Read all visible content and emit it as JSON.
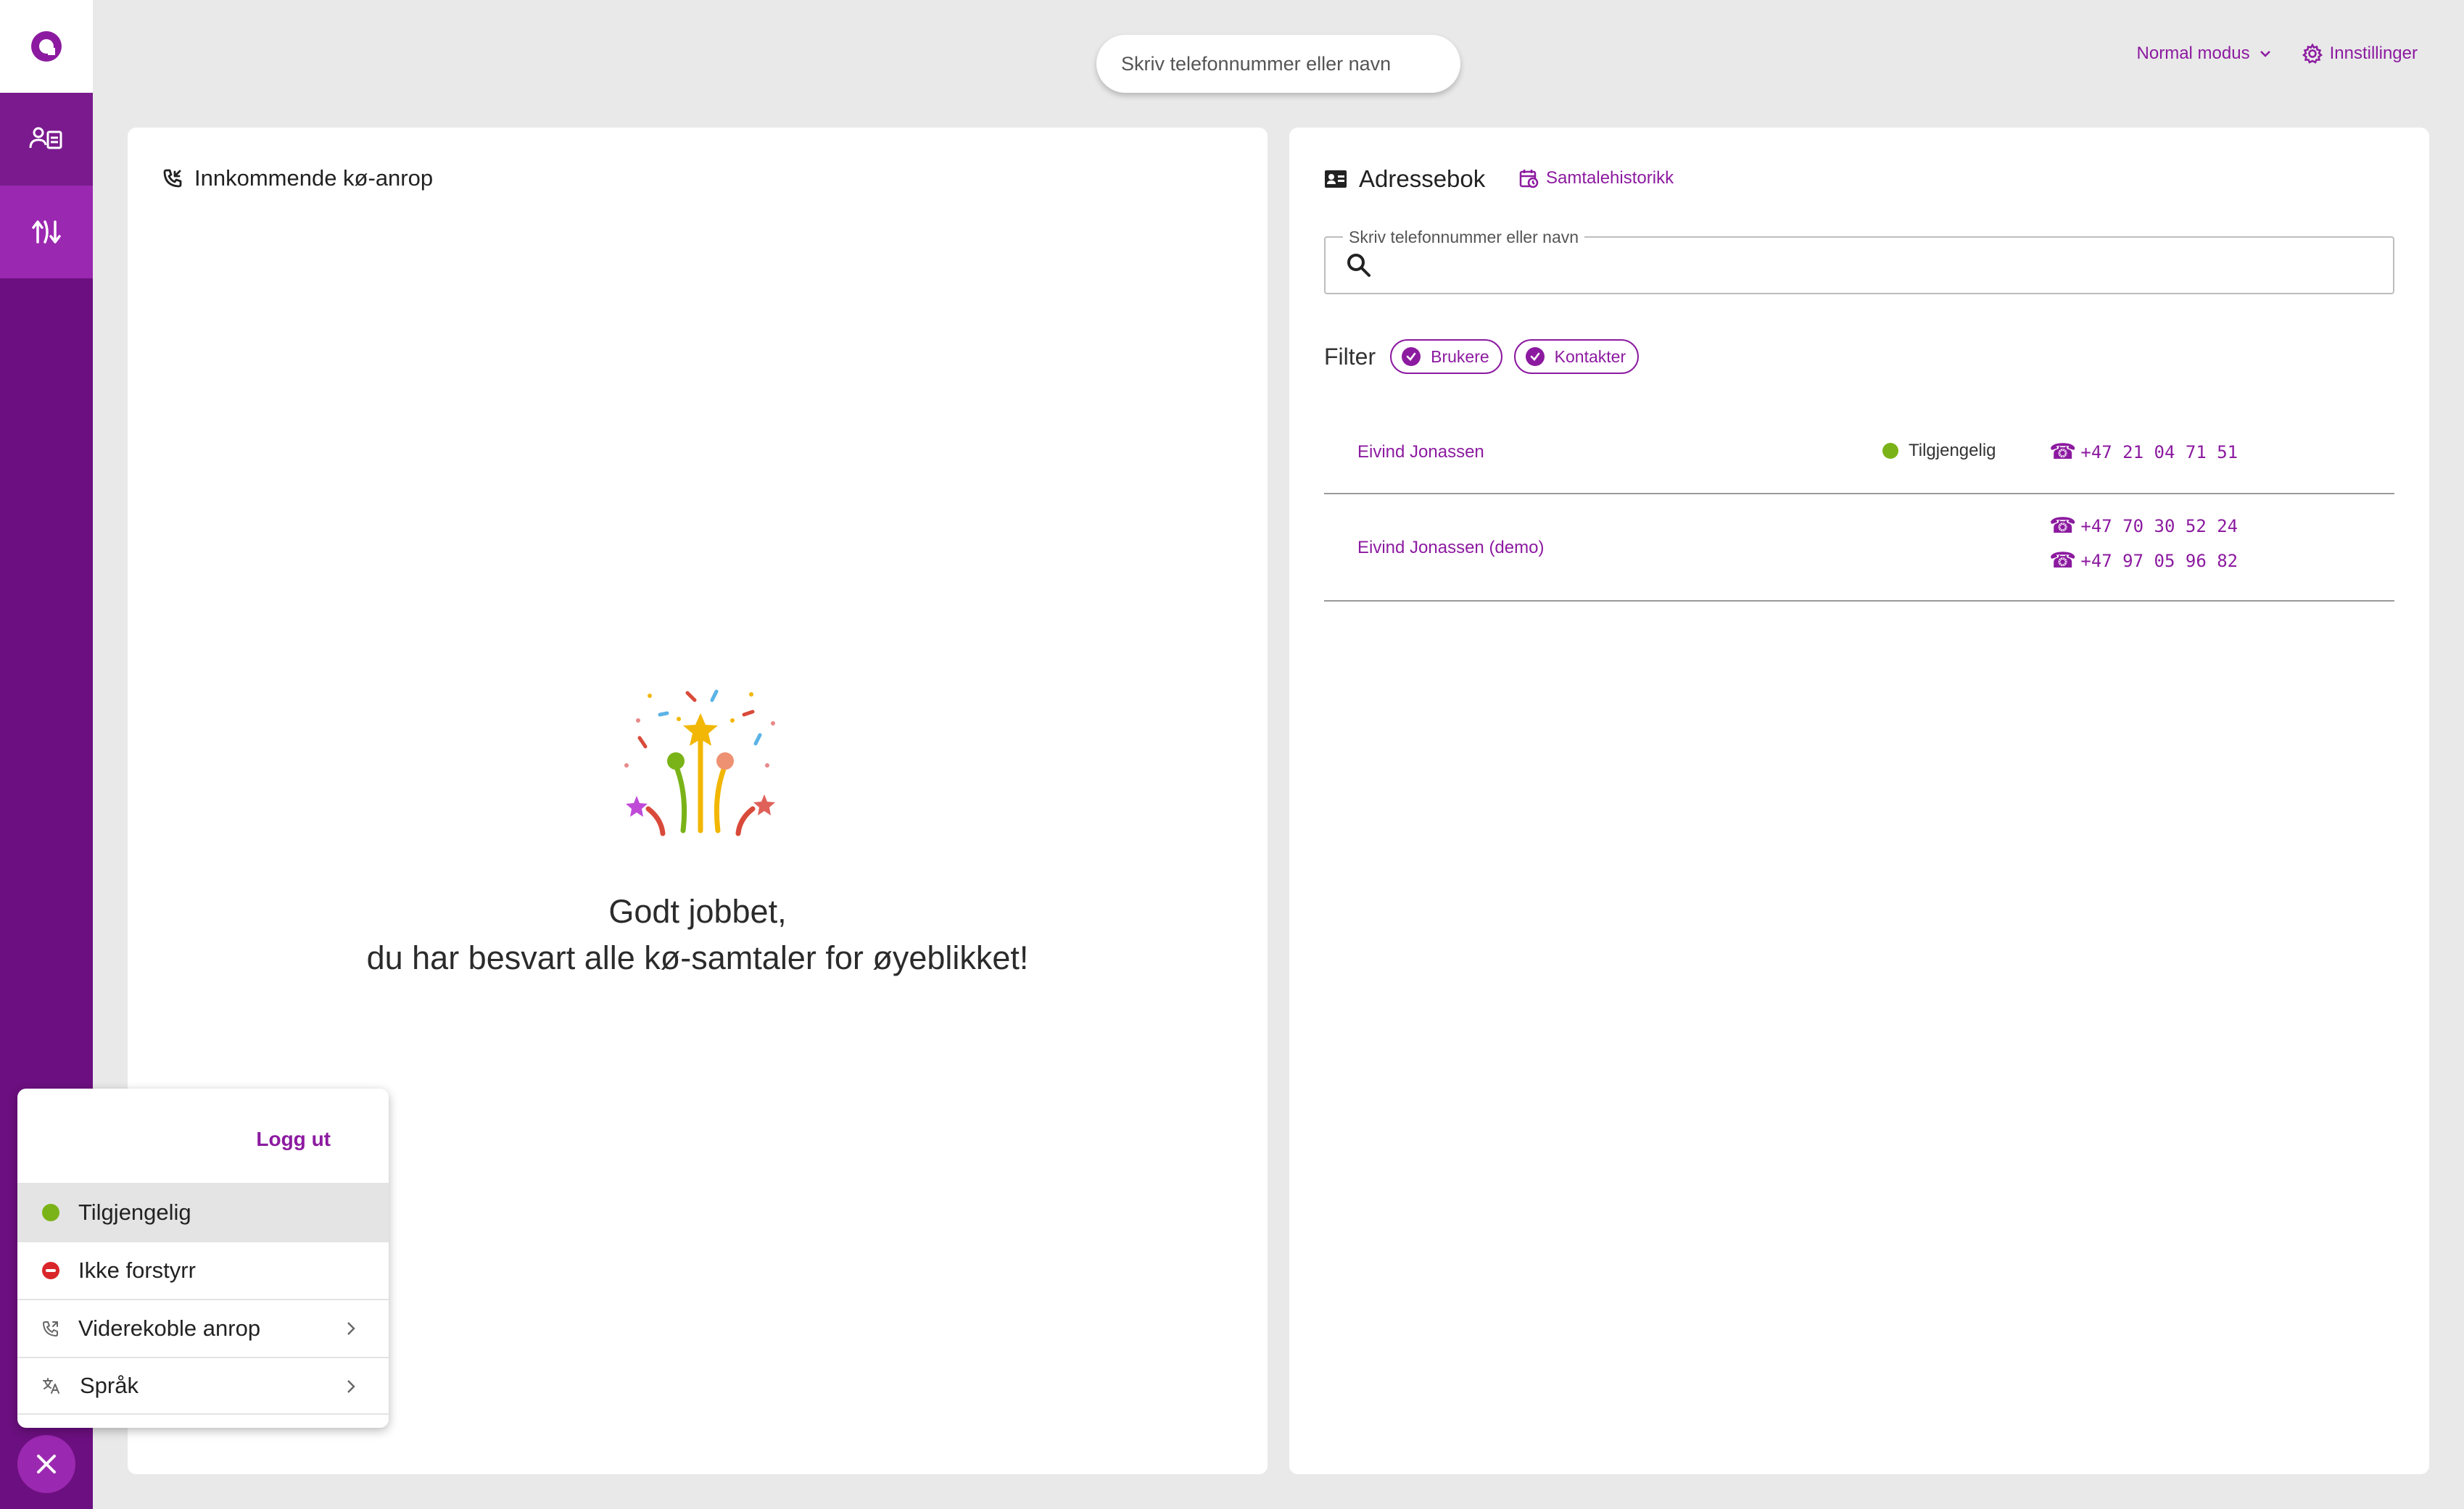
{
  "top": {
    "search_placeholder": "Skriv telefonnummer eller navn",
    "mode_label": "Normal modus",
    "settings_label": "Innstillinger"
  },
  "left_panel": {
    "title": "Innkommende kø-anrop",
    "done_line1": "Godt jobbet,",
    "done_line2": "du har besvart alle kø-samtaler for øyeblikket!"
  },
  "right_panel": {
    "title": "Adressebok",
    "history_label": "Samtalehistorikk",
    "search_label": "Skriv telefonnummer eller navn",
    "filter_label": "Filter",
    "chips": [
      "Brukere",
      "Kontakter"
    ],
    "contacts": [
      {
        "name": "Eivind Jonassen",
        "status": "Tilgjengelig",
        "phones": [
          "+47 21 04 71 51"
        ]
      },
      {
        "name": "Eivind Jonassen (demo)",
        "status": "",
        "phones": [
          "+47 70 30 52 24",
          "+47 97 05 96 82"
        ]
      }
    ]
  },
  "popup": {
    "logout": "Logg ut",
    "items": [
      "Tilgjengelig",
      "Ikke forstyrr",
      "Viderekoble anrop",
      "Språk"
    ]
  },
  "colors": {
    "brand": "#8c1aa0",
    "sidebar": "#6c0f80",
    "available": "#7ab317",
    "dnd": "#d9262b"
  },
  "icons": [
    "app-logo-icon",
    "contacts-icon",
    "queue-icon",
    "close-icon",
    "chevron-down-icon",
    "gear-icon",
    "phone-incoming-icon",
    "address-book-icon",
    "history-icon",
    "search-icon",
    "check-icon",
    "phone-icon",
    "forward-call-icon",
    "translate-icon",
    "chevron-right-icon",
    "celebration-icon"
  ]
}
